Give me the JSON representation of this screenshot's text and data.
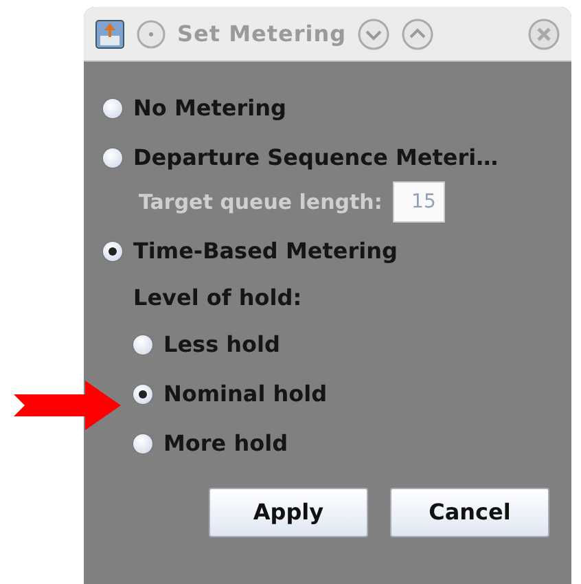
{
  "window": {
    "title": "Set Metering"
  },
  "metering_options": [
    {
      "label": "No Metering",
      "selected": false
    },
    {
      "label": "Departure Sequence Meteri…",
      "selected": false,
      "field": {
        "label": "Target queue length:",
        "value": "15",
        "disabled": true
      }
    },
    {
      "label": "Time-Based Metering",
      "selected": true,
      "hold": {
        "label": "Level of hold:",
        "options": [
          {
            "label": "Less hold",
            "selected": false
          },
          {
            "label": "Nominal hold",
            "selected": true
          },
          {
            "label": "More hold",
            "selected": false
          }
        ]
      }
    }
  ],
  "buttons": [
    "Apply",
    "Cancel"
  ],
  "annotation": {
    "kind": "arrow"
  }
}
